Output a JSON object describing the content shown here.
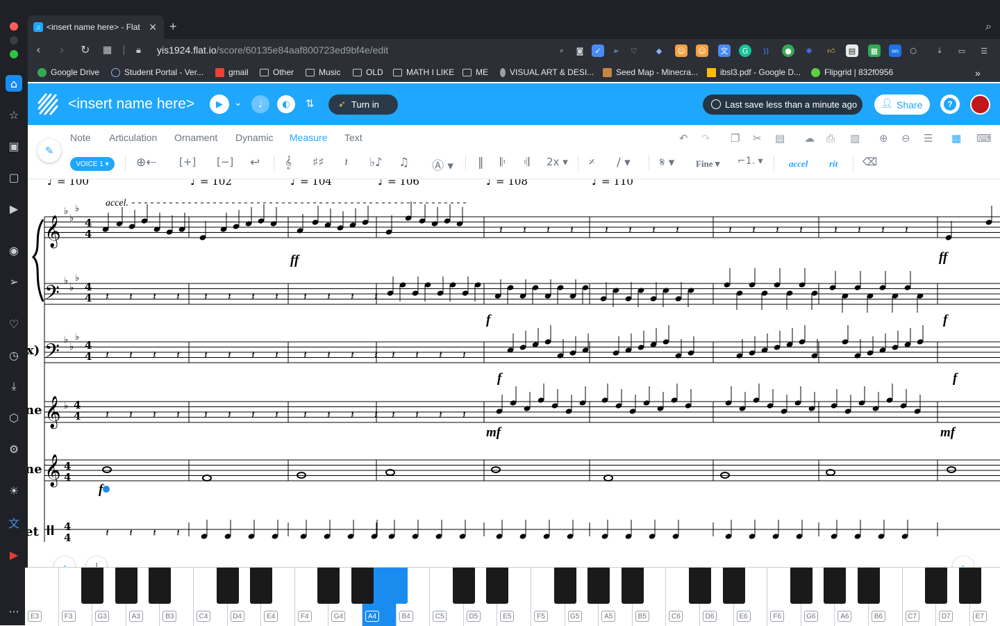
{
  "browser": {
    "tab_title": "<insert name here> - Flat",
    "url_host": "yis1924.flat.io",
    "url_path": "/score/60135e84aaf800723ed9bf4e/edit"
  },
  "bookmarks": [
    {
      "label": "Google Drive",
      "color": "#34a853"
    },
    {
      "label": "Student Portal - Ver...",
      "color": "#8ab4f8"
    },
    {
      "label": "gmail",
      "color": "#ea4335"
    },
    {
      "label": "Other",
      "color": ""
    },
    {
      "label": "Music",
      "color": ""
    },
    {
      "label": "OLD",
      "color": ""
    },
    {
      "label": "MATH I LIKE",
      "color": ""
    },
    {
      "label": "ME",
      "color": ""
    },
    {
      "label": "VISUAL ART & DESI...",
      "color": "#9aa0a6"
    },
    {
      "label": "Seed Map - Minecra...",
      "color": "#c68642"
    },
    {
      "label": "ibsl3.pdf - Google D...",
      "color": "#fbbc04"
    },
    {
      "label": "Flipgrid | 832f0956",
      "color": "#5fcf40"
    }
  ],
  "header": {
    "score_title": "<insert name here>",
    "turn_in_label": "Turn in",
    "last_save": "Last save less than a minute ago",
    "share_label": "Share"
  },
  "menu_tabs": [
    "Note",
    "Articulation",
    "Ornament",
    "Dynamic",
    "Measure",
    "Text"
  ],
  "active_tab": "Measure",
  "voice_label": "VOICE 1",
  "tools": {
    "repeat_count": "2x",
    "fine_label": "Fine",
    "accel_label": "accel",
    "rit_label": "rit"
  },
  "score": {
    "tempo_marks": [
      "= 100",
      "= 102",
      "= 104",
      "= 106",
      "= 108",
      "= 110"
    ],
    "accel_text": "accel.",
    "instrument_labels": [
      "x)",
      "ne",
      "ne",
      "et"
    ],
    "dynamics": [
      "ff",
      "ff",
      "f",
      "f",
      "f",
      "f",
      "mf",
      "mf",
      "f"
    ]
  },
  "keyboard": {
    "keys": [
      "E3",
      "F3",
      "G3",
      "A3",
      "B3",
      "C4",
      "D4",
      "E4",
      "F4",
      "G4",
      "A4",
      "B4",
      "C5",
      "D5",
      "E5",
      "F5",
      "G5",
      "A5",
      "B5",
      "C6",
      "D6",
      "E6",
      "F6",
      "G6",
      "A6",
      "B6",
      "C7",
      "D7",
      "E7"
    ],
    "active_key": "A4"
  },
  "colors": {
    "brand": "#1ea7fd",
    "active_key": "#1a8cf0"
  }
}
